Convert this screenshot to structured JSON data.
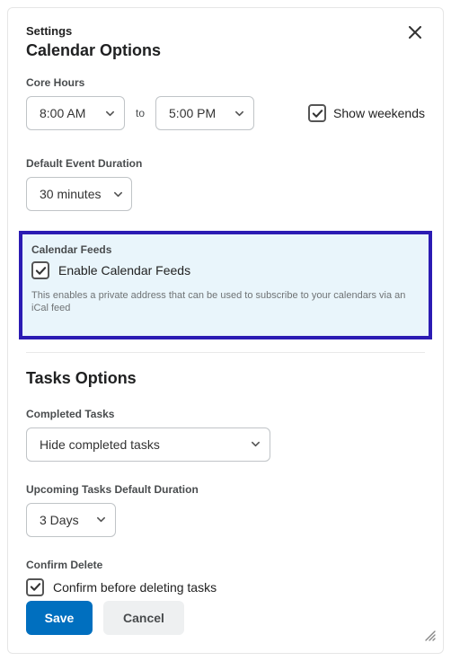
{
  "header": {
    "small_title": "Settings",
    "title": "Calendar Options"
  },
  "core_hours": {
    "label": "Core Hours",
    "start": "8:00 AM",
    "to_label": "to",
    "end": "5:00 PM",
    "show_weekends_label": "Show weekends"
  },
  "default_duration": {
    "label": "Default Event Duration",
    "value": "30 minutes"
  },
  "feeds": {
    "label": "Calendar Feeds",
    "enable_label": "Enable Calendar Feeds",
    "description": "This enables a private address that can be used to subscribe to your calendars via an iCal feed"
  },
  "tasks": {
    "heading": "Tasks Options",
    "completed": {
      "label": "Completed Tasks",
      "value": "Hide completed tasks"
    },
    "upcoming": {
      "label": "Upcoming Tasks Default Duration",
      "value": "3 Days"
    },
    "confirm": {
      "label": "Confirm Delete",
      "checkbox_label": "Confirm before deleting tasks"
    }
  },
  "footer": {
    "save": "Save",
    "cancel": "Cancel"
  }
}
